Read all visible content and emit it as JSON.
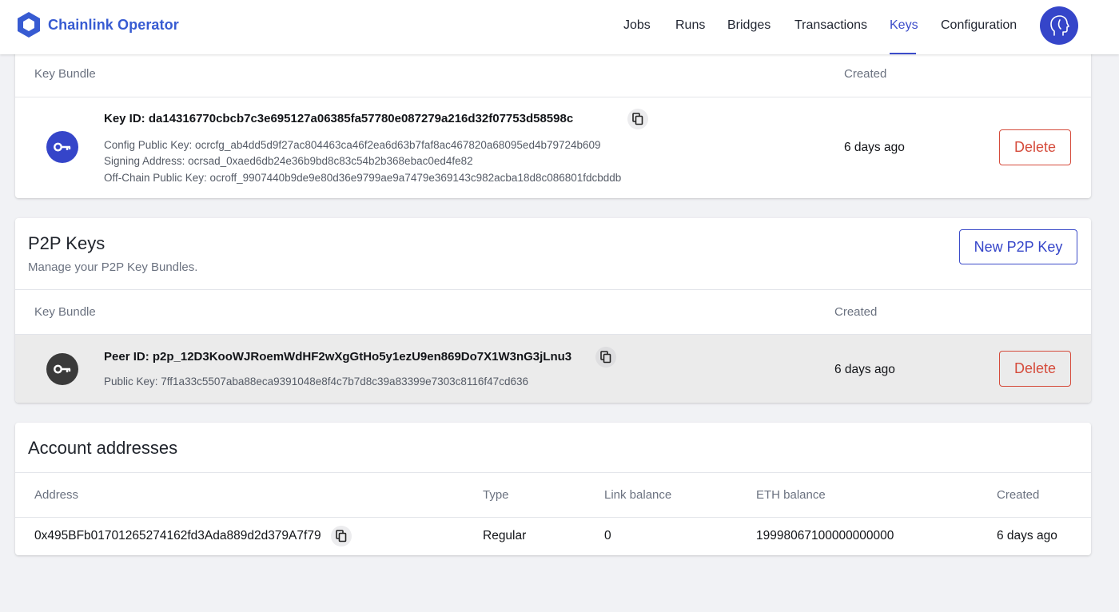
{
  "app": {
    "brand": "Chainlink Operator"
  },
  "nav": {
    "items": [
      {
        "label": "Jobs"
      },
      {
        "label": "Runs"
      },
      {
        "label": "Bridges"
      },
      {
        "label": "Transactions"
      },
      {
        "label": "Keys",
        "active": true
      },
      {
        "label": "Configuration"
      }
    ]
  },
  "ocr_keys": {
    "columns": {
      "bundle": "Key Bundle",
      "created": "Created"
    },
    "row": {
      "key_id": "Key ID: da14316770cbcb7c3e695127a06385fa57780e087279a216d32f07753d58598c",
      "config_public_key": "Config Public Key: ocrcfg_ab4dd5d9f27ac804463ca46f2ea6d63b7faf8ac467820a68095ed4b79724b609",
      "signing_address": "Signing Address: ocrsad_0xaed6db24e36b9bd8c83c54b2b368ebac0ed4fe82",
      "offchain_public_key": "Off-Chain Public Key: ocroff_9907440b9de9e80d36e9799ae9a7479e369143c982acba18d8c086801fdcbddb",
      "created": "6 days ago",
      "delete_label": "Delete"
    }
  },
  "p2p_keys": {
    "title": "P2P Keys",
    "subtitle": "Manage your P2P Key Bundles.",
    "new_button": "New P2P Key",
    "columns": {
      "bundle": "Key Bundle",
      "created": "Created"
    },
    "row": {
      "peer_id": "Peer ID: p2p_12D3KooWJRoemWdHF2wXgGtHo5y1ezU9en869Do7X1W3nG3jLnu3",
      "public_key": "Public Key: 7ff1a33c5507aba88eca9391048e8f4c7b7d8c39a83399e7303c8116f47cd636",
      "created": "6 days ago",
      "delete_label": "Delete"
    }
  },
  "accounts": {
    "title": "Account addresses",
    "columns": {
      "address": "Address",
      "type": "Type",
      "link_balance": "Link balance",
      "eth_balance": "ETH balance",
      "created": "Created"
    },
    "rows": [
      {
        "address": "0x495BFb01701265274162fd3Ada889d2d379A7f79",
        "type": "Regular",
        "link_balance": "0",
        "eth_balance": "19998067100000000000",
        "created": "6 days ago"
      }
    ]
  },
  "colors": {
    "brand": "#375bd2",
    "accent": "#3c4cc9",
    "danger": "#d54b3b",
    "ocr_icon": "#3545c9",
    "p2p_icon": "#3a3a3a"
  }
}
